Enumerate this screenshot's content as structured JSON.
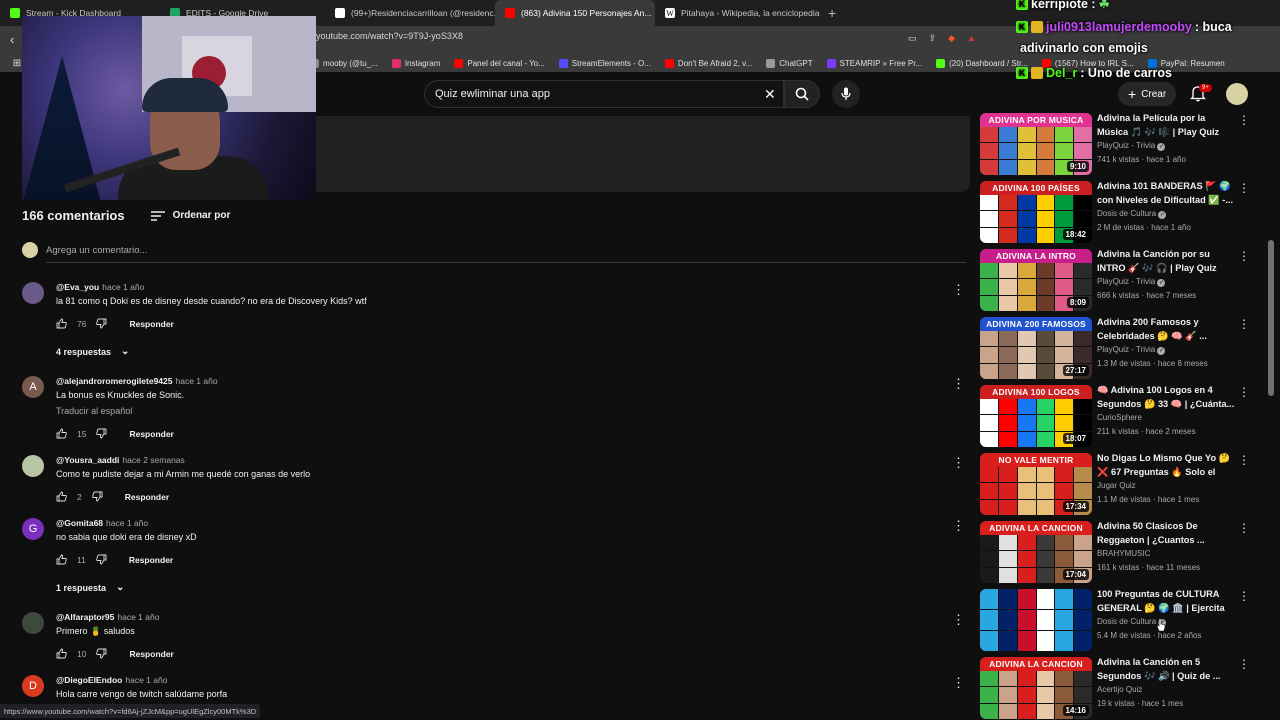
{
  "browser": {
    "tabs": [
      {
        "label": "Stream - Kick Dashboard",
        "color": "#53fc18"
      },
      {
        "label": "EDITS - Google Drive",
        "color": "#1fa463"
      },
      {
        "label": "(99+)Residenciacarrilloan (@residenc...",
        "color": "#ffffff"
      },
      {
        "label": "(863) Adivina 150 Personajes An...",
        "color": "#ff0000"
      },
      {
        "label": "Pitahaya - Wikipedia, la enciclopedia...",
        "color": "#ffffff"
      }
    ],
    "url": "youtube.com/watch?v=9T9J-yoS3X8",
    "bookmarks": [
      {
        "label": "mooby (@tu_...",
        "color": "#888888"
      },
      {
        "label": "Instagram",
        "color": "#e1306c"
      },
      {
        "label": "Panel del canal - Yo...",
        "color": "#ff0000"
      },
      {
        "label": "StreamElements - O...",
        "color": "#5b4bff"
      },
      {
        "label": "Don't Be Afraid 2, v...",
        "color": "#ff0000"
      },
      {
        "label": "ChatGPT",
        "color": "#9a9a9a"
      },
      {
        "label": "STEAMRIP » Free Pr...",
        "color": "#7a3cff"
      },
      {
        "label": "(20) Dashboard / Str...",
        "color": "#53fc18"
      },
      {
        "label": "(1567) How to IRL S...",
        "color": "#ff0000"
      },
      {
        "label": "PayPal: Resumen",
        "color": "#0070e0"
      }
    ]
  },
  "header": {
    "search_value": "Quiz ewliminar una app",
    "create_label": "Crear",
    "notification_count": "9+"
  },
  "chat": [
    {
      "user": "kerripiote :",
      "message": "",
      "user_color": "#ffffff"
    },
    {
      "user": "juli0913lamujerdemooby",
      "message": ": buca",
      "user_color": "#c24bff"
    },
    {
      "user": "",
      "message": "adivinarlo con emojis",
      "user_color": "#ffffff"
    },
    {
      "user": "Del_r",
      "message": ": Uno de carros",
      "user_color": "#53fc18"
    }
  ],
  "comments_section": {
    "count_label": "166 comentarios",
    "sort_label": "Ordenar por",
    "add_placeholder": "Agrega un comentario...",
    "comments": [
      {
        "author": "@Eva_you",
        "time": "hace 1 año",
        "text": "la 81 como q Doki es de disney desde cuando? no era de Discovery Kids? wtf",
        "likes": "76",
        "avatar_letter": "",
        "avatar_color": "#6a5a8a",
        "replies": "4 respuestas"
      },
      {
        "author": "@alejandroromerogilete9425",
        "time": "hace 1 año",
        "text": "La bonus es Knuckles de Sonic.",
        "translate": "Traducir al español",
        "likes": "15",
        "avatar_letter": "A",
        "avatar_color": "#7a5a4e",
        "replies": ""
      },
      {
        "author": "@Yousra_aaddi",
        "time": "hace 2 semanas",
        "text": "Como te pudiste dejar a mi Armin me quedé con ganas de verlo",
        "likes": "2",
        "avatar_letter": "",
        "avatar_color": "#b9c6a3",
        "replies": ""
      },
      {
        "author": "@Gomita68",
        "time": "hace 1 año",
        "text": "no sabia que doki era de disney xD",
        "likes": "11",
        "avatar_letter": "G",
        "avatar_color": "#7b2fbf",
        "replies": "1 respuesta"
      },
      {
        "author": "@Alfaraptor95",
        "time": "hace 1 año",
        "text": "Primero 🍍 saludos",
        "likes": "10",
        "avatar_letter": "",
        "avatar_color": "#3b4a3a",
        "replies": ""
      },
      {
        "author": "@DiegoElEndoo",
        "time": "hace 1 año",
        "text": "Hola carre vengo de twitch salúdame porfa",
        "likes": "",
        "avatar_letter": "D",
        "avatar_color": "#d93b1f",
        "replies": ""
      }
    ],
    "reply_label": "Responder"
  },
  "status_url": "https://www.youtube.com/watch?v=fd6Aj-jZJcM&pp=ugUlEgZlcy00MTk%3D",
  "recommendations": [
    {
      "banner": "ADIVINA POR MUSICA",
      "banner_color": "#e0338f",
      "title": "Adivina la Película por la Música 🎵 🎶 🎼 | Play Quiz de...",
      "channel": "PlayQuiz - Trivia",
      "verified": true,
      "meta": "741 k vistas · hace 1 año",
      "duration": "9:10",
      "palette": [
        "#d43b3b",
        "#3b7bd4",
        "#e0c03b",
        "#d47b3b",
        "#7bd43b",
        "#e06fa6"
      ]
    },
    {
      "banner": "ADIVINA 100 PAÍSES",
      "banner_color": "#cc1f1f",
      "title": "Adivina 101 BANDERAS 🚩 🌍 con Niveles de Dificultad ✅ -...",
      "channel": "Dosis de Cultura",
      "verified": true,
      "meta": "2 M de vistas · hace 1 año",
      "duration": "18:42",
      "palette": [
        "#ffffff",
        "#d52b1e",
        "#0039a6",
        "#ffce00",
        "#009b3a",
        "#000000"
      ]
    },
    {
      "banner": "ADIVINA LA INTRO",
      "banner_color": "#c61e8a",
      "title": "Adivina la Canción por su INTRO 🎸 🎶 🎧 | Play Quiz de...",
      "channel": "PlayQuiz - Trivia",
      "verified": true,
      "meta": "666 k vistas · hace 7 meses",
      "duration": "8:09",
      "palette": [
        "#3bb34a",
        "#e8c9a6",
        "#d9a83b",
        "#6b3b2a",
        "#e05a8a",
        "#2a2a2a"
      ]
    },
    {
      "banner": "ADIVINA 200 FAMOSOS",
      "banner_color": "#1f52cc",
      "title": "Adivina 200 Famosos y Celebridades 🤔 🧠 🎸 ...",
      "channel": "PlayQuiz - Trivia",
      "verified": true,
      "meta": "1.3 M de vistas · hace 8 meses",
      "duration": "27:17",
      "palette": [
        "#c9a48a",
        "#8a6b5a",
        "#e0c9b0",
        "#5a4a3a",
        "#d4b49a",
        "#3a2a2a"
      ]
    },
    {
      "banner": "ADIVINA 100 LOGOS",
      "banner_color": "#cc1f1f",
      "title": "🧠 Adivina 100 Logos en 4 Segundos 🤔 33 🧠 | ¿Cuánta...",
      "channel": "CurioSphere",
      "verified": false,
      "meta": "211 k vistas · hace 2 meses",
      "duration": "18:07",
      "palette": [
        "#ffffff",
        "#ff0000",
        "#1877f2",
        "#25d366",
        "#ffcc00",
        "#000000"
      ]
    },
    {
      "banner": "NO VALE MENTIR",
      "banner_color": "#d91e1e",
      "title": "No Digas Lo Mismo Que Yo 🤔 ❌ 67 Preguntas 🔥 Solo el 5%...",
      "channel": "Jugar Quiz",
      "verified": false,
      "meta": "1.1 M de vistas · hace 1 mes",
      "duration": "17:34",
      "palette": [
        "#d91e1e",
        "#d91e1e",
        "#e8c07a",
        "#e8c07a",
        "#d91e1e",
        "#b58a4a"
      ]
    },
    {
      "banner": "ADIVINA LA CANCION",
      "banner_color": "#d91e1e",
      "title": "Adivina 50 Clasicos De Reggaeton | ¿Cuantos ...",
      "channel": "BRAHYMUSIC",
      "verified": false,
      "meta": "161 k vistas · hace 11 meses",
      "duration": "17:04",
      "palette": [
        "#1a1a1a",
        "#e0e0e0",
        "#d91e1e",
        "#3a3a3a",
        "#8a5a3a",
        "#c9a48a"
      ]
    },
    {
      "banner": "",
      "banner_color": "#2aa6e0",
      "title": "100 Preguntas de CULTURA GENERAL 🤔 🌍 🏛️ | Ejercita t...",
      "channel": "Dosis de Cultura",
      "verified": true,
      "meta": "5.4 M de vistas · hace 2 años",
      "duration": "",
      "palette": [
        "#2aa6e0",
        "#012169",
        "#c8102e",
        "#ffffff",
        "#2aa6e0",
        "#012169"
      ]
    },
    {
      "banner": "ADIVINA LA CANCION",
      "banner_color": "#d91e1e",
      "title": "Adivina la Canción en 5 Segundos 🎶 🔊 | Quiz de ...",
      "channel": "Acertijo Quiz",
      "verified": false,
      "meta": "19 k vistas · hace 1 mes",
      "duration": "14:16",
      "palette": [
        "#3bb34a",
        "#c9a48a",
        "#d91e1e",
        "#e8c9a6",
        "#8a5a3a",
        "#2a2a2a"
      ]
    }
  ]
}
